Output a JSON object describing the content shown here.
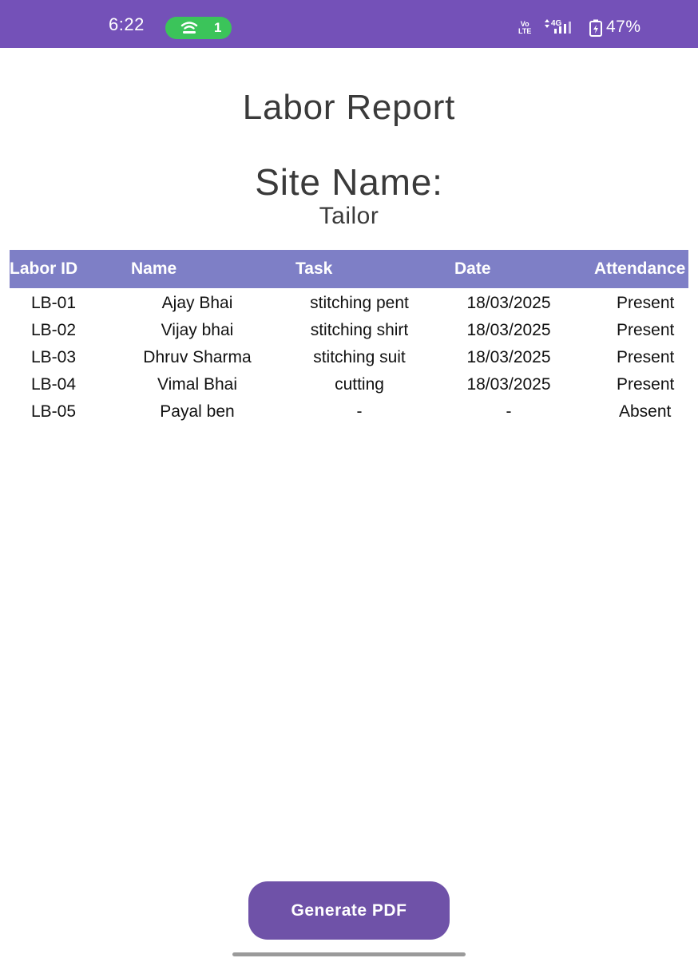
{
  "status_bar": {
    "time": "6:22",
    "hotspot_count": "1",
    "volte_top": "Vo",
    "volte_bottom": "LTE",
    "network": "4G",
    "battery": "47%",
    "icons": [
      "hotspot-icon",
      "volte-icon",
      "signal-icon",
      "battery-icon"
    ]
  },
  "report": {
    "title": "Labor Report",
    "site_label": "Site Name:",
    "site_value": "Tailor"
  },
  "table": {
    "headers": [
      "Labor ID",
      "Name",
      "Task",
      "Date",
      "Attendance"
    ],
    "rows": [
      [
        "LB-01",
        "Ajay Bhai",
        "stitching pent",
        "18/03/2025",
        "Present"
      ],
      [
        "LB-02",
        "Vijay bhai",
        "stitching shirt",
        "18/03/2025",
        "Present"
      ],
      [
        "LB-03",
        "Dhruv Sharma",
        "stitching suit",
        "18/03/2025",
        "Present"
      ],
      [
        "LB-04",
        "Vimal Bhai",
        "cutting",
        "18/03/2025",
        "Present"
      ],
      [
        "LB-05",
        "Payal ben",
        "-",
        "-",
        "Absent"
      ]
    ]
  },
  "actions": {
    "generate_pdf_label": "Generate PDF"
  },
  "colors": {
    "status_bar": "#7451b8",
    "table_header": "#7e7fc6",
    "button": "#6f52a8",
    "hotspot_pill": "#3bc45a"
  }
}
